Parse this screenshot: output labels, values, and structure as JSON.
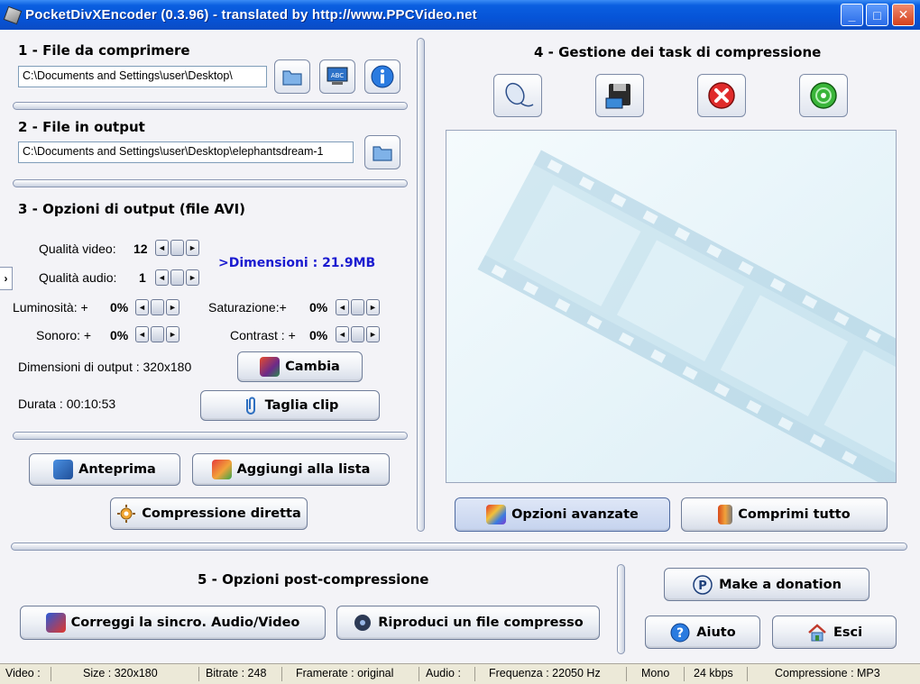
{
  "window": {
    "title": "PocketDivXEncoder (0.3.96) - translated by http://www.PPCVideo.net",
    "minimize": "_",
    "maximize": "□",
    "close": "✕"
  },
  "section1": {
    "heading": "1 - File da comprimere",
    "path": "C:\\Documents and Settings\\user\\Desktop\\"
  },
  "section2": {
    "heading": "2 - File in output",
    "path": "C:\\Documents and Settings\\user\\Desktop\\elephantsdream-1"
  },
  "section3": {
    "heading": "3 - Opzioni di output (file AVI)",
    "quality_video_label": "Qualità video:",
    "quality_video_value": "12",
    "quality_audio_label": "Qualità audio:",
    "quality_audio_value": "1",
    "dimensions_estimate": ">Dimensioni : 21.9MB",
    "luminosity_label": "Luminosità: +",
    "luminosity_value": "0%",
    "saturation_label": "Saturazione:+",
    "saturation_value": "0%",
    "sound_label": "Sonoro: +",
    "sound_value": "0%",
    "contrast_label": "Contrast : +",
    "contrast_value": "0%",
    "output_dims": "Dimensioni di output : 320x180",
    "change_button": "Cambia",
    "duration": "Durata : 00:10:53",
    "trim_button": "Taglia clip"
  },
  "actions": {
    "preview_button": "Anteprima",
    "add_to_list_button": "Aggiungi alla lista",
    "direct_compression_button": "Compressione diretta"
  },
  "section4": {
    "heading": "4 - Gestione dei task di compressione",
    "advanced_options_button": "Opzioni avanzate",
    "compress_all_button": "Comprimi tutto"
  },
  "section5": {
    "heading": "5 - Opzioni post-compressione",
    "fix_sync_button": "Correggi la sincro. Audio/Video",
    "play_button": "Riproduci un file compresso",
    "donation_button": "Make a donation",
    "help_button": "Aiuto",
    "exit_button": "Esci"
  },
  "statusbar": {
    "video": "Video :",
    "size": "Size : 320x180",
    "bitrate": "Bitrate : 248",
    "framerate": "Framerate : original",
    "audio": "Audio :",
    "frequency": "Frequenza : 22050 Hz",
    "channels": "Mono",
    "kbps": "24 kbps",
    "compression": "Compressione : MP3"
  },
  "spinner": {
    "left": "◄",
    "right": "►"
  },
  "side_toggle": "›",
  "colors": {
    "accent_blue_text": "#1a1ad0",
    "titlebar": "#0654d8"
  }
}
